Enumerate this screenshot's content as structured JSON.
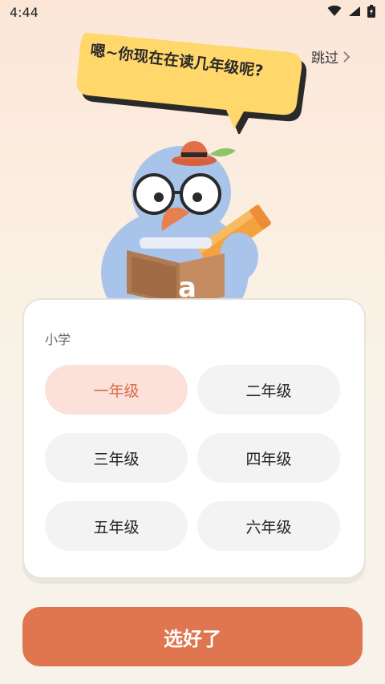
{
  "status_bar": {
    "time": "4:44"
  },
  "skip": {
    "label": "跳过"
  },
  "speech_bubble": {
    "text": "嗯~你现在在读几年级呢?"
  },
  "section": {
    "label": "小学"
  },
  "grades": [
    {
      "label": "一年级",
      "selected": true
    },
    {
      "label": "二年级",
      "selected": false
    },
    {
      "label": "三年级",
      "selected": false
    },
    {
      "label": "四年级",
      "selected": false
    },
    {
      "label": "五年级",
      "selected": false
    },
    {
      "label": "六年级",
      "selected": false
    }
  ],
  "mascot": {
    "book_letter": "a"
  },
  "confirm": {
    "label": "选好了"
  },
  "colors": {
    "accent": "#e0764f",
    "selected_bg": "#fbe1d9",
    "selected_text": "#d86b48",
    "bubble": "#ffd76a"
  }
}
